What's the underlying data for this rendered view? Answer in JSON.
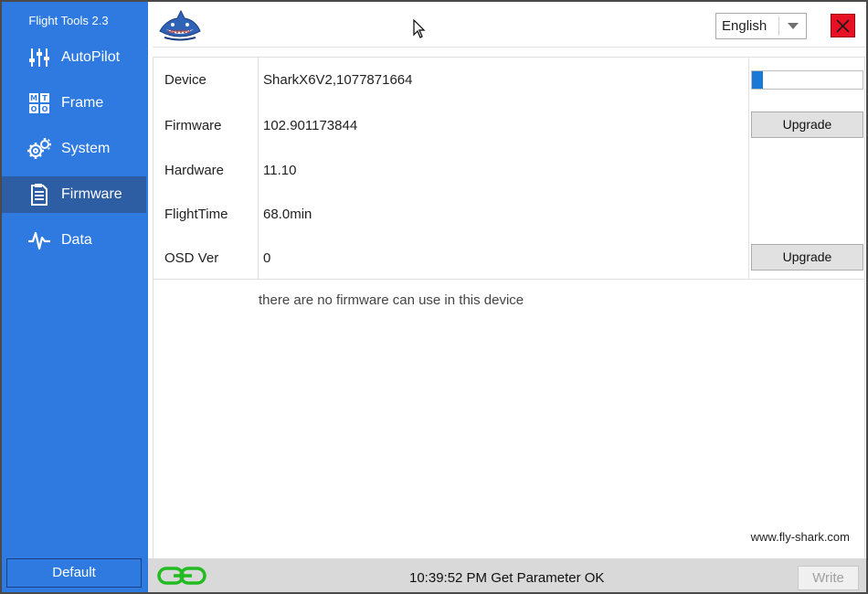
{
  "app": {
    "title": "Flight Tools 2.3"
  },
  "sidebar": {
    "items": [
      {
        "label": "AutoPilot",
        "icon": "sliders-icon",
        "active": false
      },
      {
        "label": "Frame",
        "icon": "mt-oo-icon",
        "active": false
      },
      {
        "label": "System",
        "icon": "gears-icon",
        "active": false
      },
      {
        "label": "Firmware",
        "icon": "document-icon",
        "active": true
      },
      {
        "label": "Data",
        "icon": "pulse-icon",
        "active": false
      }
    ],
    "default_label": "Default"
  },
  "header": {
    "language": {
      "selected": "English"
    },
    "close_icon": "close-icon",
    "logo_icon": "shark-logo-icon"
  },
  "info": {
    "rows": [
      {
        "label": "Device",
        "value": "SharkX6V2,1077871664"
      },
      {
        "label": "Firmware",
        "value": "102.901173844"
      },
      {
        "label": "Hardware",
        "value": "11.10"
      },
      {
        "label": "FlightTime",
        "value": "68.0min"
      },
      {
        "label": "OSD Ver",
        "value": "0"
      }
    ],
    "progress_fraction": 0.1,
    "upgrade_label": "Upgrade",
    "osd_upgrade_label": "Upgrade",
    "message": "there are no firmware can use in this device",
    "website": "www.fly-shark.com"
  },
  "status": {
    "text": "10:39:52 PM Get Parameter OK",
    "write_label": "Write",
    "link_icon": "link-icon"
  },
  "colors": {
    "sidebar": "#2f7ae0",
    "sidebar_active": "#2d5da3",
    "progress_fill": "#1a78d6",
    "close": "#e81123",
    "link": "#22bb22"
  }
}
